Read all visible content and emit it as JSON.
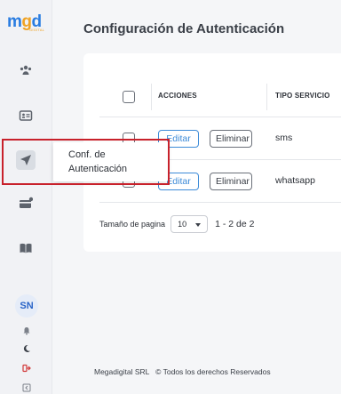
{
  "brand": {
    "logo_m": "m",
    "logo_g": "g",
    "logo_d": "d",
    "logo_sub": "DIGITAL"
  },
  "sidebar": {
    "items": [
      {
        "icon": "team-icon"
      },
      {
        "icon": "contact-card-icon"
      },
      {
        "icon": "send-icon",
        "active": true
      },
      {
        "icon": "payment-card-icon"
      },
      {
        "icon": "book-icon"
      }
    ],
    "tooltip": {
      "line1": "Conf. de",
      "line2": "Autenticación"
    },
    "user_initials": "SN",
    "bottom_icons": [
      "bell-icon",
      "moon-icon",
      "logout-icon",
      "collapse-icon"
    ]
  },
  "page": {
    "title": "Configuración de Autenticación"
  },
  "table": {
    "columns": [
      "ACCIONES",
      "TIPO SERVICIO"
    ],
    "rows": [
      {
        "edit_label": "Editar",
        "delete_label": "Eliminar",
        "tipo": "sms"
      },
      {
        "edit_label": "Editar",
        "delete_label": "Eliminar",
        "tipo": "whatsapp"
      }
    ]
  },
  "pagination": {
    "label": "Tamaño de pagina",
    "page_size": "10",
    "range": "1 - 2 de 2"
  },
  "footer": {
    "text": "Megadigital SRL   © Todos los derechos Reservados"
  },
  "colors": {
    "accent": "#3d8bd8",
    "highlight": "#c8212b",
    "brand_blue": "#2a7de1",
    "brand_orange": "#f0a325"
  }
}
